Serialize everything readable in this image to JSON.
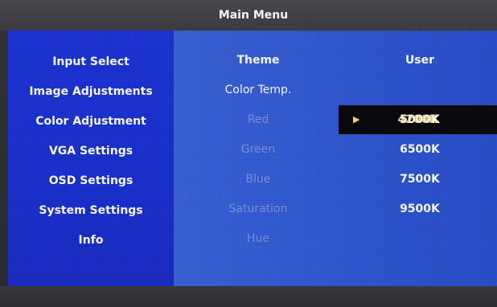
{
  "title": "Main Menu",
  "sidebar": {
    "items": [
      {
        "label": "Input Select"
      },
      {
        "label": "Image Adjustments"
      },
      {
        "label": "Color Adjustment"
      },
      {
        "label": "VGA Settings"
      },
      {
        "label": "OSD Settings"
      },
      {
        "label": "System Settings"
      },
      {
        "label": "Info"
      }
    ]
  },
  "params": [
    {
      "label": "Theme"
    },
    {
      "label": "Color Temp."
    },
    {
      "label": "Red"
    },
    {
      "label": "Green"
    },
    {
      "label": "Blue"
    },
    {
      "label": "Saturation"
    },
    {
      "label": "Hue"
    }
  ],
  "theme_value": "User",
  "color_temp": {
    "selected_marker": "▶",
    "options": [
      {
        "label": "4200K"
      },
      {
        "label": "5000K"
      },
      {
        "label": "6500K"
      },
      {
        "label": "7500K"
      },
      {
        "label": "9500K"
      }
    ]
  },
  "colors": {
    "sidebar_blue": "#1d34d6",
    "content_blue": "#3a63d8",
    "selected_text": "#ffd27a",
    "dim_text": "#7c93dc"
  }
}
